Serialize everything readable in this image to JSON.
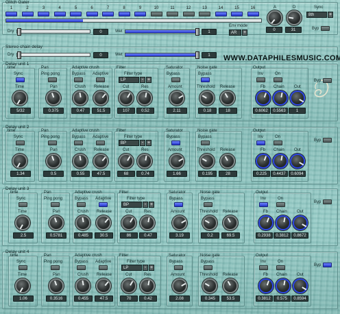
{
  "glitch": {
    "title": "Glitch Gater",
    "steps": [
      {
        "label": "1",
        "on": true
      },
      {
        "label": "2",
        "on": true
      },
      {
        "label": "3",
        "on": true
      },
      {
        "label": "4",
        "on": true
      },
      {
        "label": "5",
        "on": true
      },
      {
        "label": "6",
        "on": true
      },
      {
        "label": "7",
        "on": true
      },
      {
        "label": "8",
        "on": true
      },
      {
        "label": "9",
        "on": true
      },
      {
        "label": "10",
        "on": false
      },
      {
        "label": "11",
        "on": false
      },
      {
        "label": "12",
        "on": false
      },
      {
        "label": "13",
        "on": false
      },
      {
        "label": "14",
        "on": true
      },
      {
        "label": "15",
        "on": true
      },
      {
        "label": "16",
        "on": true
      }
    ],
    "a_label": "A",
    "d_label": "D",
    "a_value": "0",
    "d_value": "31",
    "sync_label": "Sync",
    "sync_value": "8th",
    "byp_label": "Byp",
    "dry_label": "Dry",
    "dry_value": "0",
    "wet_label": "Wet",
    "wet_value": "1",
    "env_mode_label": "Env mode",
    "env_mode_value": "AR",
    "step_level_fraction": 0.3,
    "dry_fraction": 0.0,
    "wet_fraction": 1.0
  },
  "stereo": {
    "title": "Stereo chain delay",
    "dry_label": "Dry",
    "dry_value": "0",
    "wet_label": "Wet",
    "wet_value": "1",
    "website": "WWW.DATAPHILESMUSIC.COM",
    "dry_fraction": 0.0,
    "wet_fraction": 1.0
  },
  "labels": {
    "time": "time",
    "sync": "Sync",
    "time_knob": "Time",
    "pan": "Pan",
    "ping_pong": "Ping pong",
    "pan_knob": "Pan",
    "adaptive_crush": "Adaptive crush",
    "bypass": "Bypass",
    "adaptive": "Adaptive",
    "crush": "Crush",
    "release": "Release",
    "filter": "Filter",
    "filter_type": "Filter type",
    "cut": "Cut",
    "res": "Res",
    "saturator": "Saturator",
    "amount": "Amount",
    "noise_gate": "Noise gate",
    "threshold": "Threshold",
    "output": "Output",
    "inv": "Inv",
    "on": "On",
    "fb": "Fb",
    "chain": "Chain",
    "out": "Out",
    "byp": "Byp",
    "plus": "+",
    "minus": "-"
  },
  "units": [
    {
      "title": "Delay unit 1",
      "time": "5/32",
      "pan": "0.375",
      "crush": "0.47",
      "crush_release": "51.5",
      "filter_type": "LP",
      "cut": "107",
      "res": "0.52",
      "amount": "2.11",
      "threshold": "0.18",
      "gate_release": "18",
      "fb": "0.6062",
      "chain": "0.5563",
      "out": "1",
      "sync_on": true,
      "ping_on": false,
      "crush_bypass_on": false,
      "adaptive_on": false,
      "sat_bypass_on": false,
      "gate_bypass_on": true,
      "inv_on": false,
      "on_on": false,
      "byp_on": false
    },
    {
      "title": "Delay unit 2",
      "time": "1.34",
      "pan": "0.5",
      "crush": "0.55",
      "crush_release": "47.5",
      "filter_type": "BP",
      "cut": "68",
      "res": "0.74",
      "amount": "1.66",
      "threshold": "0.195",
      "gate_release": "28",
      "fb": "0.225",
      "chain": "0.4437",
      "out": "0.6094",
      "sync_on": false,
      "ping_on": false,
      "crush_bypass_on": false,
      "adaptive_on": false,
      "sat_bypass_on": true,
      "gate_bypass_on": false,
      "inv_on": true,
      "on_on": false,
      "byp_on": false
    },
    {
      "title": "Delay unit 3",
      "time": "2.5",
      "pan": "0.5781",
      "crush": "0.485",
      "crush_release": "30.5",
      "filter_type": "BP",
      "cut": "86",
      "res": "0.47",
      "amount": "3.19",
      "threshold": "0.2",
      "gate_release": "69.5",
      "fb": "0.2938",
      "chain": "0.3812",
      "out": "0.8672",
      "sync_on": false,
      "ping_on": false,
      "crush_bypass_on": false,
      "adaptive_on": true,
      "sat_bypass_on": true,
      "gate_bypass_on": false,
      "inv_on": true,
      "on_on": false,
      "byp_on": false
    },
    {
      "title": "Delay unit 4",
      "time": "1.06",
      "pan": "0.3516",
      "crush": "0.455",
      "crush_release": "47.5",
      "filter_type": "LP",
      "cut": "70",
      "res": "0.42",
      "amount": "2.08",
      "threshold": "0.345",
      "gate_release": "53.5",
      "fb": "0.3812",
      "chain": "0.575",
      "out": "0.8594",
      "sync_on": false,
      "ping_on": false,
      "crush_bypass_on": false,
      "adaptive_on": false,
      "sat_bypass_on": false,
      "gate_bypass_on": false,
      "inv_on": false,
      "on_on": false,
      "byp_on": true
    }
  ],
  "colors": {
    "accent_blue": "#2233c8",
    "panel_bg": "#8fc4c0",
    "display_bg": "#2d3a3a"
  }
}
